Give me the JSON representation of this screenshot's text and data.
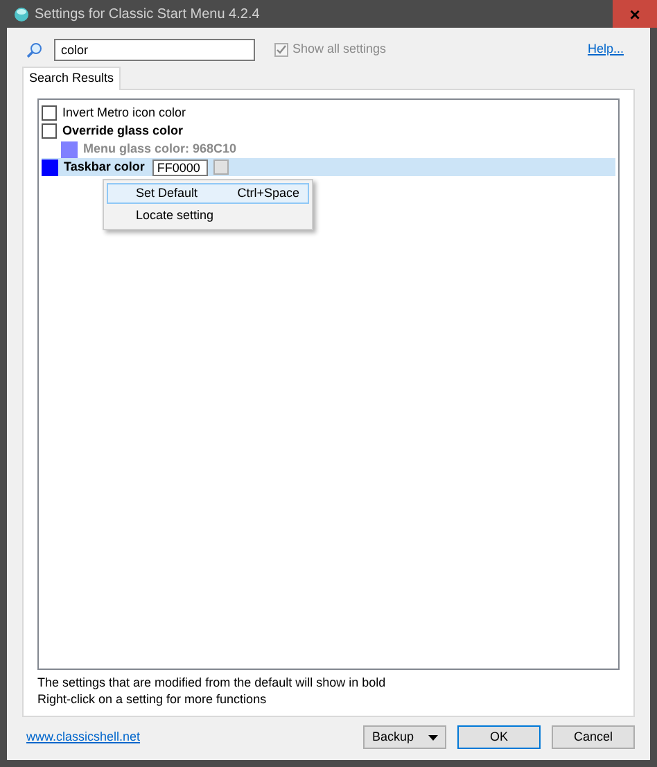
{
  "window": {
    "title": "Settings for Classic Start Menu 4.2.4",
    "close": "×"
  },
  "search": {
    "value": "color"
  },
  "show_all": {
    "label": "Show all settings",
    "checked": true,
    "disabled": true
  },
  "help_link": "Help...",
  "tabs": [
    {
      "label": "Search Results",
      "selected": true
    }
  ],
  "settings": [
    {
      "kind": "checkbox",
      "label": "Invert Metro icon color",
      "bold": false,
      "checked": false,
      "selected": false
    },
    {
      "kind": "checkbox",
      "label": "Override glass color",
      "bold": true,
      "checked": false,
      "selected": false,
      "children": [
        {
          "kind": "color",
          "label": "Menu glass color: 968C10",
          "bold": true,
          "disabled": true,
          "color": "#8080ff",
          "selected": false
        }
      ]
    },
    {
      "kind": "color_edit",
      "label": "Taskbar color",
      "bold": true,
      "disabled": false,
      "color": "#0000ff",
      "value": "FF0000",
      "selected": true
    }
  ],
  "context_menu": [
    {
      "label": "Set Default",
      "shortcut": "Ctrl+Space",
      "selected": true
    },
    {
      "label": "Locate setting",
      "selected": false
    }
  ],
  "notes": [
    "The settings that are modified from the default will show in bold",
    "Right-click on a setting for more functions"
  ],
  "website_link": "www.classicshell.net",
  "buttons": [
    {
      "label": "Backup",
      "kind": "dropdown"
    },
    {
      "label": "OK",
      "kind": "default"
    },
    {
      "label": "Cancel",
      "kind": "plain"
    }
  ]
}
